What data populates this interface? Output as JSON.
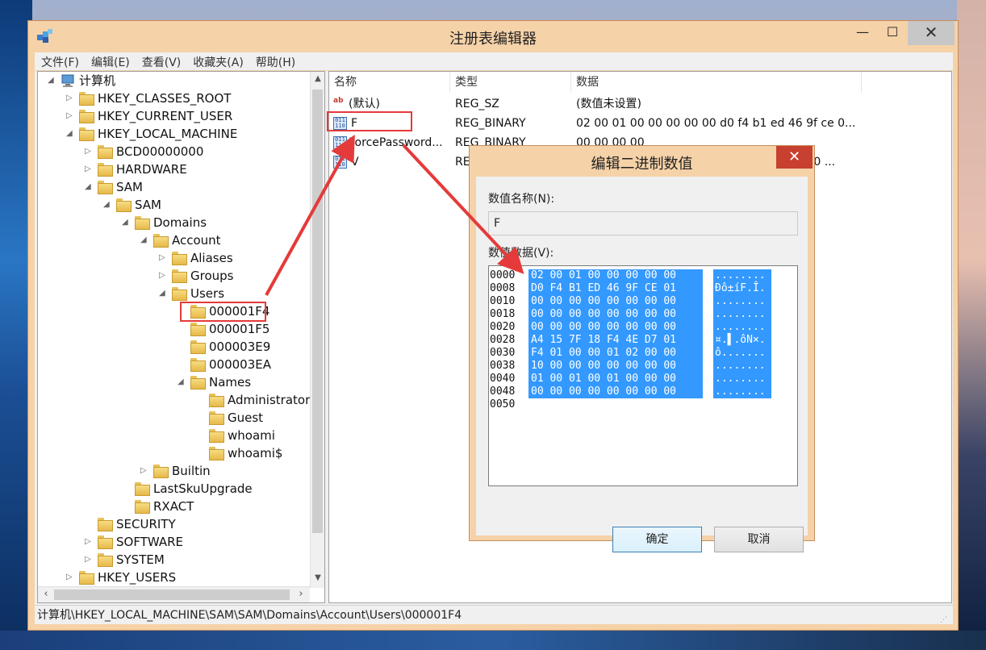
{
  "window": {
    "title": "注册表编辑器",
    "minimize_glyph": "—",
    "maximize_glyph": "☐",
    "close_glyph": "✕"
  },
  "menu": [
    "文件(F)",
    "编辑(E)",
    "查看(V)",
    "收藏夹(A)",
    "帮助(H)"
  ],
  "tree": {
    "items": [
      {
        "label": "计算机",
        "expander": "◢"
      },
      {
        "label": "HKEY_CLASSES_ROOT",
        "expander": "▷"
      },
      {
        "label": "HKEY_CURRENT_USER",
        "expander": "▷"
      },
      {
        "label": "HKEY_LOCAL_MACHINE",
        "expander": "◢"
      },
      {
        "label": "BCD00000000",
        "expander": "▷"
      },
      {
        "label": "HARDWARE",
        "expander": "▷"
      },
      {
        "label": "SAM",
        "expander": "◢"
      },
      {
        "label": "SAM",
        "expander": "◢"
      },
      {
        "label": "Domains",
        "expander": "◢"
      },
      {
        "label": "Account",
        "expander": "◢"
      },
      {
        "label": "Aliases",
        "expander": "▷"
      },
      {
        "label": "Groups",
        "expander": "▷"
      },
      {
        "label": "Users",
        "expander": "◢"
      },
      {
        "label": "000001F4",
        "expander": ""
      },
      {
        "label": "000001F5",
        "expander": ""
      },
      {
        "label": "000003E9",
        "expander": ""
      },
      {
        "label": "000003EA",
        "expander": ""
      },
      {
        "label": "Names",
        "expander": "◢"
      },
      {
        "label": "Administrator",
        "expander": ""
      },
      {
        "label": "Guest",
        "expander": ""
      },
      {
        "label": "whoami",
        "expander": ""
      },
      {
        "label": "whoami$",
        "expander": ""
      },
      {
        "label": "Builtin",
        "expander": "▷"
      },
      {
        "label": "LastSkuUpgrade",
        "expander": ""
      },
      {
        "label": "RXACT",
        "expander": ""
      },
      {
        "label": "SECURITY",
        "expander": ""
      },
      {
        "label": "SOFTWARE",
        "expander": "▷"
      },
      {
        "label": "SYSTEM",
        "expander": "▷"
      },
      {
        "label": "HKEY_USERS",
        "expander": "▷"
      }
    ]
  },
  "list": {
    "headers": [
      "名称",
      "类型",
      "数据"
    ],
    "rows": [
      {
        "icon": "string-value-icon",
        "name": "(默认)",
        "type": "REG_SZ",
        "data": "(数值未设置)"
      },
      {
        "icon": "binary-value-icon",
        "name": "F",
        "type": "REG_BINARY",
        "data": "02 00 01 00 00 00 00 00 d0 f4 b1 ed 46 9f ce 0..."
      },
      {
        "icon": "binary-value-icon",
        "name": "ForcePassword...",
        "type": "REG_BINARY",
        "data": "00 00 00 00"
      },
      {
        "icon": "binary-value-icon",
        "name": "V",
        "type": "REG_BINARY",
        "data": "00 00 00 00 f4 00 00 00 03 00 01 00 00 00 ..."
      }
    ]
  },
  "status": {
    "path": "计算机\\HKEY_LOCAL_MACHINE\\SAM\\SAM\\Domains\\Account\\Users\\000001F4"
  },
  "dialog": {
    "title": "编辑二进制数值",
    "close_glyph": "✕",
    "name_label": "数值名称(N):",
    "name_value": "F",
    "data_label": "数值数据(V):",
    "hex_lines": [
      {
        "offset": "0000",
        "bytes": "02 00 01 00 00 00 00 00",
        "ascii": "........"
      },
      {
        "offset": "0008",
        "bytes": "D0 F4 B1 ED 46 9F CE 01",
        "ascii": "Ðô±íF.Î."
      },
      {
        "offset": "0010",
        "bytes": "00 00 00 00 00 00 00 00",
        "ascii": "........"
      },
      {
        "offset": "0018",
        "bytes": "00 00 00 00 00 00 00 00",
        "ascii": "........"
      },
      {
        "offset": "0020",
        "bytes": "00 00 00 00 00 00 00 00",
        "ascii": "........"
      },
      {
        "offset": "0028",
        "bytes": "A4 15 7F 18 F4 4E D7 01",
        "ascii": "¤.▌.ôN×."
      },
      {
        "offset": "0030",
        "bytes": "F4 01 00 00 01 02 00 00",
        "ascii": "ô......."
      },
      {
        "offset": "0038",
        "bytes": "10 00 00 00 00 00 00 00",
        "ascii": "........"
      },
      {
        "offset": "0040",
        "bytes": "01 00 01 00 01 00 00 00",
        "ascii": "........"
      },
      {
        "offset": "0048",
        "bytes": "00 00 00 00 00 00 00 00",
        "ascii": "........"
      },
      {
        "offset": "0050",
        "bytes": "",
        "ascii": ""
      }
    ],
    "ok_label": "确定",
    "cancel_label": "取消"
  },
  "colors": {
    "highlight": "#3399ff",
    "annotation_red": "#e53a3a",
    "window_frame": "#f6d2a8"
  }
}
